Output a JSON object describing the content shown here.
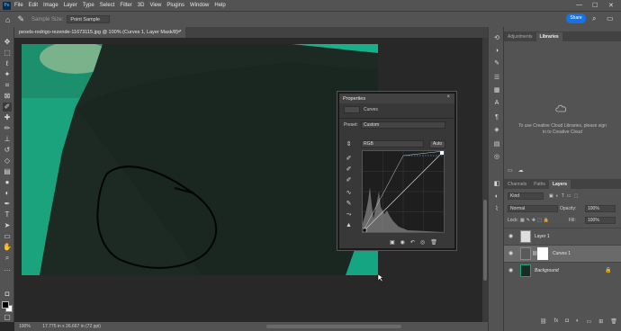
{
  "menu": {
    "logo": "Ps",
    "items": [
      "File",
      "Edit",
      "Image",
      "Layer",
      "Type",
      "Select",
      "Filter",
      "3D",
      "View",
      "Plugins",
      "Window",
      "Help"
    ],
    "window_controls": [
      "—",
      "☐",
      "✕"
    ]
  },
  "options": {
    "sample_size_label": "Sample Size:",
    "sample_size_value": "Point Sample",
    "share_label": "Share"
  },
  "document": {
    "tab_title": "pexels-rodrigo-rezende-11673115.jpg @ 100% (Curves 1, Layer Mask/8) *",
    "tab_close": "×",
    "status_zoom": "100%",
    "status_size": "17.775 in x 26.667 in (72 ppi)"
  },
  "properties": {
    "title": "Properties",
    "close": "×",
    "adjustment_name": "Curves",
    "preset_label": "Preset:",
    "preset_value": "Custom",
    "channel_value": "RGB",
    "auto_label": "Auto"
  },
  "right_panel": {
    "tabs_top": [
      "Adjustments",
      "Libraries"
    ],
    "active_top_tab": "Libraries",
    "library_message": "To use Creative Cloud Libraries, please sign in to Creative Cloud",
    "tabs_layers": [
      "Channels",
      "Paths",
      "Layers"
    ],
    "active_layers_tab": "Layers",
    "kind_value": "Kind",
    "blend_value": "Normal",
    "opacity_label": "Opacity:",
    "opacity_value": "100%",
    "lock_label": "Lock:",
    "fill_label": "Fill:",
    "fill_value": "100%",
    "layers": [
      {
        "name": "Layer 1",
        "selected": false
      },
      {
        "name": "Curves 1",
        "selected": true
      },
      {
        "name": "Background",
        "selected": false
      }
    ]
  },
  "colors": {
    "accent": "#1473e6",
    "teal": "#1fb38a",
    "jacket": "#1e2a24"
  },
  "icons": {
    "toolbar": [
      "move-icon",
      "marquee-icon",
      "lasso-icon",
      "quick-select-icon",
      "crop-icon",
      "frame-icon",
      "eyedropper-icon",
      "healing-icon",
      "brush-icon",
      "stamp-icon",
      "history-brush-icon",
      "eraser-icon",
      "gradient-icon",
      "blur-icon",
      "dodge-icon",
      "pen-icon",
      "type-icon",
      "path-select-icon",
      "rectangle-icon",
      "hand-icon",
      "zoom-icon"
    ]
  }
}
